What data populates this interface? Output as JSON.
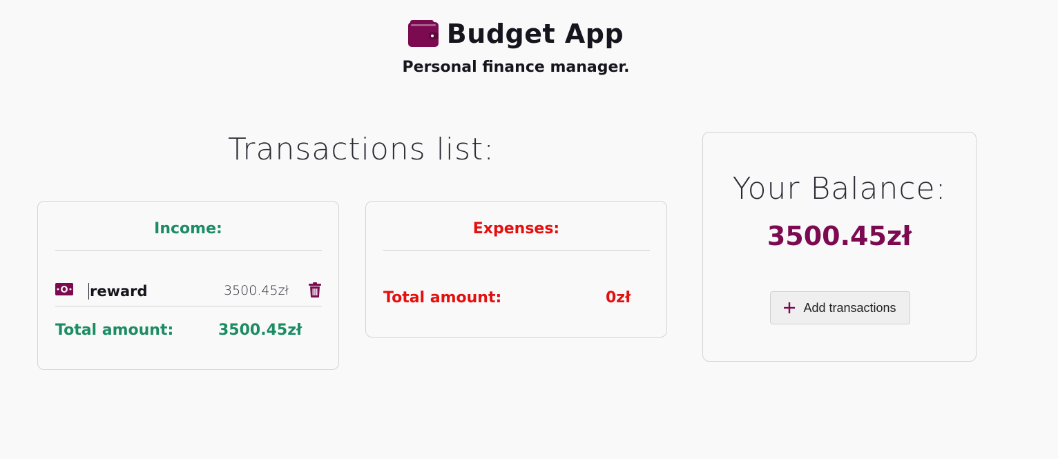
{
  "header": {
    "title": "Budget App",
    "subtitle": "Personal finance manager.",
    "icon": "wallet-icon"
  },
  "transactions": {
    "heading": "Transactions list:"
  },
  "income": {
    "title": "Income:",
    "items": [
      {
        "icon": "money-bill-icon",
        "name": "reward",
        "amount": "3500.45zł"
      }
    ],
    "total_label": "Total amount:",
    "total_value": "3500.45zł"
  },
  "expenses": {
    "title": "Expenses:",
    "total_label": "Total amount:",
    "total_value": "0zł"
  },
  "balance": {
    "heading": "Your Balance:",
    "value": "3500.45zł",
    "add_button_label": "Add transactions"
  },
  "colors": {
    "brand": "#7c0a50",
    "income": "#1c8c64",
    "expense": "#e4100f",
    "background": "#f9f9f9"
  }
}
